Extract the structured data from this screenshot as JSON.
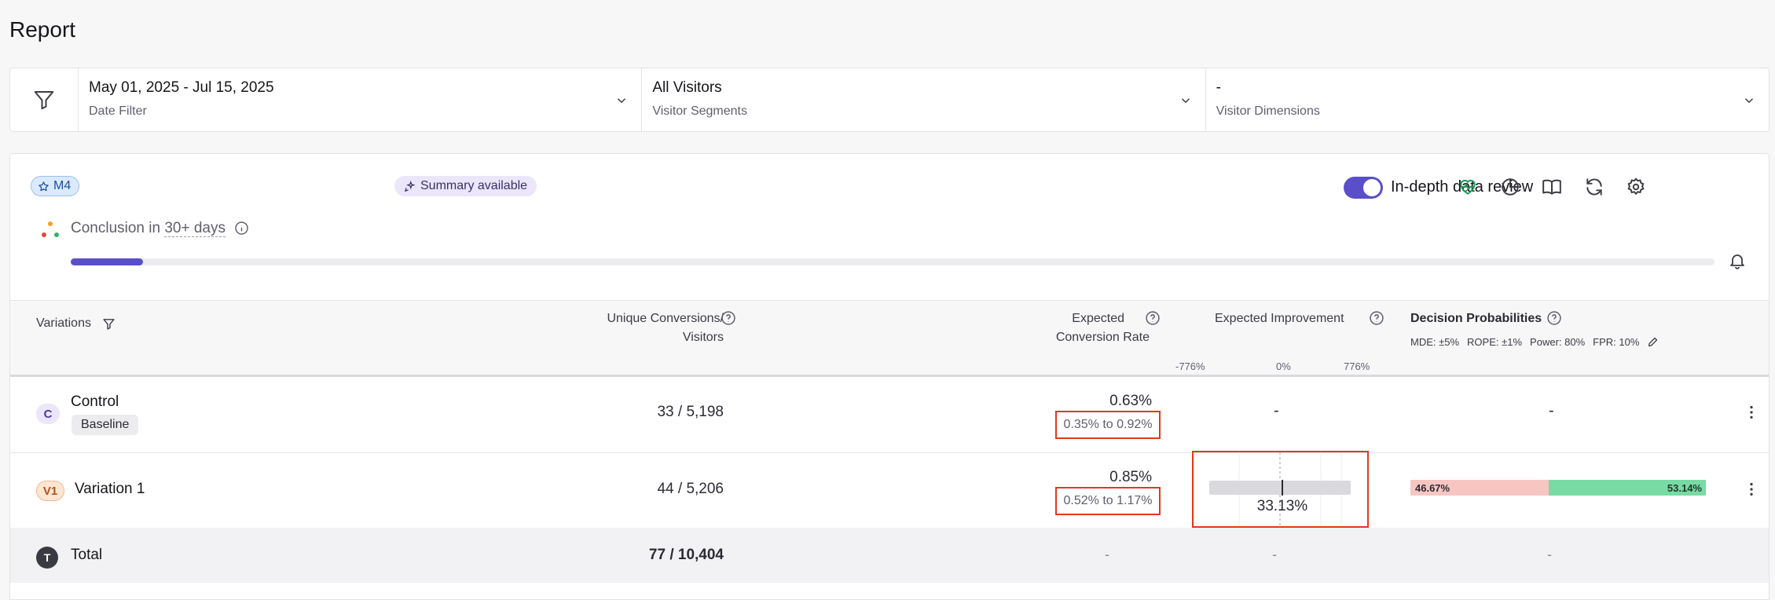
{
  "page": {
    "title": "Report"
  },
  "filters": {
    "date": {
      "value": "May 01, 2025 - Jul 15, 2025",
      "label": "Date Filter"
    },
    "segments": {
      "value": "All Visitors",
      "label": "Visitor Segments"
    },
    "dimensions": {
      "value": "-",
      "label": "Visitor Dimensions"
    }
  },
  "header": {
    "badge": "M4",
    "summary": "Summary available",
    "toggle_label": "In-depth data review",
    "toggle_on": true,
    "tools": [
      "heart-pulse-icon",
      "pie-chart-icon",
      "book-icon",
      "refresh-icon",
      "gear-icon"
    ]
  },
  "conclusion": {
    "prefix": "Conclusion in",
    "days": "30+ days",
    "progress": 0.044
  },
  "table": {
    "columns": {
      "variations": "Variations",
      "conversions_1": "Unique Conversions/",
      "conversions_2": "Visitors",
      "rate_1": "Expected",
      "rate_2": "Conversion Rate",
      "improvement": "Expected Improvement",
      "decision": "Decision Probabilities"
    },
    "scale": {
      "min": "-776%",
      "mid": "0%",
      "max": "776%"
    },
    "decision_params": {
      "mde": "MDE: ±5%",
      "rope": "ROPE: ±1%",
      "power": "Power: 80%",
      "fpr": "FPR: 10%"
    },
    "rows": [
      {
        "badge": "C",
        "name": "Control",
        "tag": "Baseline",
        "conversions": "33 / 5,198",
        "rate": "0.63%",
        "range": "0.35% to 0.92%",
        "improvement": "-",
        "decision": "-"
      },
      {
        "badge": "V1",
        "name": "Variation 1",
        "conversions": "44 / 5,206",
        "rate": "0.85%",
        "range": "0.52% to 1.17%",
        "improvement": "33.13%",
        "improvement_value": 33.13,
        "decision_neg": "46.67%",
        "decision_pos": "53.14%",
        "decision_neg_value": 46.67,
        "decision_pos_value": 53.14
      }
    ],
    "total": {
      "badge": "T",
      "name": "Total",
      "conversions": "77 / 10,404",
      "rate": "-",
      "improvement": "-",
      "decision": "-"
    }
  },
  "colors": {
    "accent": "#5b4fc9",
    "highlight": "#e0391c",
    "positive": "#78dba4",
    "negative": "#f8c6c2"
  }
}
